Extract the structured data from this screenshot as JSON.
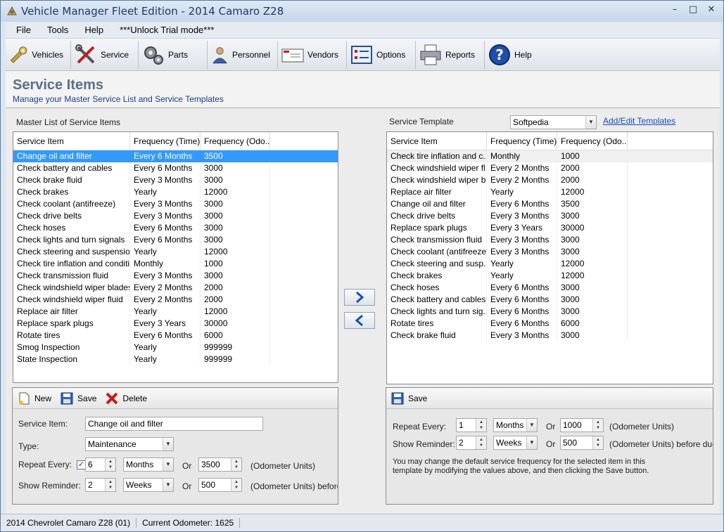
{
  "window": {
    "title": "Vehicle Manager Fleet Edition - 2014 Camaro Z28",
    "min": "–",
    "max": "□",
    "close": "✕"
  },
  "menu": [
    "File",
    "Tools",
    "Help",
    "***Unlock Trial mode***"
  ],
  "toolbar": [
    "Vehicles",
    "Service",
    "Parts",
    "Personnel",
    "Vendors",
    "Options",
    "Reports",
    "Help"
  ],
  "header": {
    "title": "Service Items",
    "subtitle": "Manage your Master Service List and Service Templates"
  },
  "master": {
    "label": "Master List of Service Items",
    "columns": [
      "Service Item",
      "Frequency (Time)",
      "Frequency (Odo..."
    ],
    "rows": [
      [
        "Change oil and filter",
        "Every 6 Months",
        "3500"
      ],
      [
        "Check battery and cables",
        "Every 6 Months",
        "3000"
      ],
      [
        "Check brake fluid",
        "Every 3 Months",
        "3000"
      ],
      [
        "Check brakes",
        "Yearly",
        "12000"
      ],
      [
        "Check coolant (antifreeze)",
        "Every 3 Months",
        "3000"
      ],
      [
        "Check drive belts",
        "Every 3 Months",
        "3000"
      ],
      [
        "Check hoses",
        "Every 6 Months",
        "3000"
      ],
      [
        "Check lights and turn signals",
        "Every 6 Months",
        "3000"
      ],
      [
        "Check steering and suspension",
        "Yearly",
        "12000"
      ],
      [
        "Check tire inflation and conditi...",
        "Monthly",
        "1000"
      ],
      [
        "Check transmission fluid",
        "Every 3 Months",
        "3000"
      ],
      [
        "Check windshield wiper blades",
        "Every 2 Months",
        "2000"
      ],
      [
        "Check windshield wiper fluid",
        "Every 2 Months",
        "2000"
      ],
      [
        "Replace air filter",
        "Yearly",
        "12000"
      ],
      [
        "Replace spark plugs",
        "Every 3 Years",
        "30000"
      ],
      [
        "Rotate tires",
        "Every 6 Months",
        "6000"
      ],
      [
        "Smog Inspection",
        "Yearly",
        "999999"
      ],
      [
        "State Inspection",
        "Yearly",
        "999999"
      ]
    ]
  },
  "template": {
    "label": "Service Template",
    "selected": "Softpedia",
    "link": "Add/Edit Templates",
    "columns": [
      "Service Item",
      "Frequency (Time)",
      "Frequency (Odo..."
    ],
    "rows": [
      [
        "Check tire inflation and c...",
        "Monthly",
        "1000"
      ],
      [
        "Check windshield wiper fl...",
        "Every 2 Months",
        "2000"
      ],
      [
        "Check windshield wiper b...",
        "Every 2 Months",
        "2000"
      ],
      [
        "Replace air filter",
        "Yearly",
        "12000"
      ],
      [
        "Change oil and filter",
        "Every 6 Months",
        "3500"
      ],
      [
        "Check drive belts",
        "Every 3 Months",
        "3000"
      ],
      [
        "Replace spark plugs",
        "Every 3 Years",
        "30000"
      ],
      [
        "Check transmission fluid",
        "Every 3 Months",
        "3000"
      ],
      [
        "Check coolant (antifreeze)",
        "Every 3 Months",
        "3000"
      ],
      [
        "Check steering and susp...",
        "Yearly",
        "12000"
      ],
      [
        "Check brakes",
        "Yearly",
        "12000"
      ],
      [
        "Check hoses",
        "Every 6 Months",
        "3000"
      ],
      [
        "Check battery and cables",
        "Every 6 Months",
        "3000"
      ],
      [
        "Check lights and turn sig...",
        "Every 6 Months",
        "3000"
      ],
      [
        "Rotate tires",
        "Every 6 Months",
        "6000"
      ],
      [
        "Check brake fluid",
        "Every 3 Months",
        "3000"
      ]
    ]
  },
  "editor": {
    "new": "New",
    "save": "Save",
    "delete": "Delete",
    "service_item_label": "Service Item:",
    "service_item_value": "Change oil and filter",
    "type_label": "Type:",
    "type_value": "Maintenance",
    "repeat_label": "Repeat Every:",
    "repeat_value": "6",
    "repeat_unit": "Months",
    "or": "Or",
    "repeat_odo": "3500",
    "odo_units": "(Odometer Units)",
    "reminder_label": "Show Reminder:",
    "reminder_value": "2",
    "reminder_unit": "Weeks",
    "reminder_odo": "500",
    "reminder_odo_units": "(Odometer Units) before"
  },
  "template_editor": {
    "save": "Save",
    "repeat_label": "Repeat Every:",
    "repeat_value": "1",
    "repeat_unit": "Months",
    "or": "Or",
    "repeat_odo": "1000",
    "odo_units": "(Odometer Units)",
    "reminder_label": "Show Reminder:",
    "reminder_value": "2",
    "reminder_unit": "Weeks",
    "reminder_odo": "500",
    "reminder_odo_units": "(Odometer Units) before due",
    "note": "You may change the default service frequency for the selected item in this template by modifying the values above, and then clicking the Save button."
  },
  "status": {
    "vehicle": "2014 Chevrolet Camaro Z28 (01)",
    "odometer": "Current Odometer: 1625"
  }
}
